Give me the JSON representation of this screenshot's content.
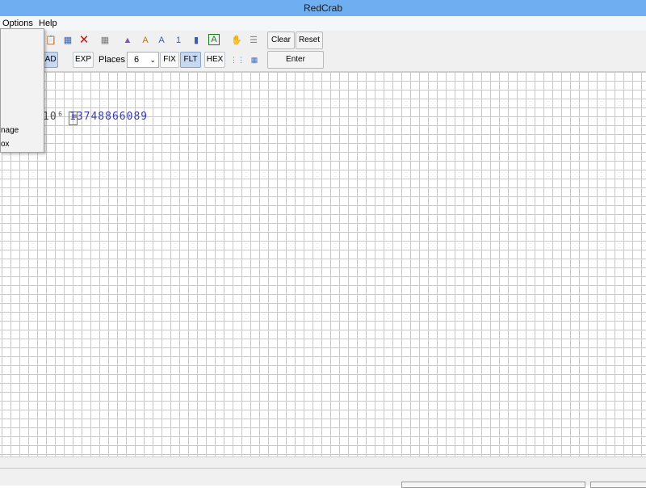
{
  "window": {
    "title": "RedCrab"
  },
  "menu": {
    "options": "Options",
    "help": "Help"
  },
  "toolbar": {
    "rad": "RAD",
    "exp": "EXP",
    "places_label": "Places",
    "places_value": "6",
    "fix": "FIX",
    "flt": "FLT",
    "hex": "HEX",
    "clear": "Clear",
    "reset": "Reset",
    "enter": "Enter"
  },
  "worksheet": {
    "expression_left": "10⁶ =",
    "result": "13748866089"
  },
  "dropdown": {
    "item1": "nage",
    "item2": "ox"
  }
}
